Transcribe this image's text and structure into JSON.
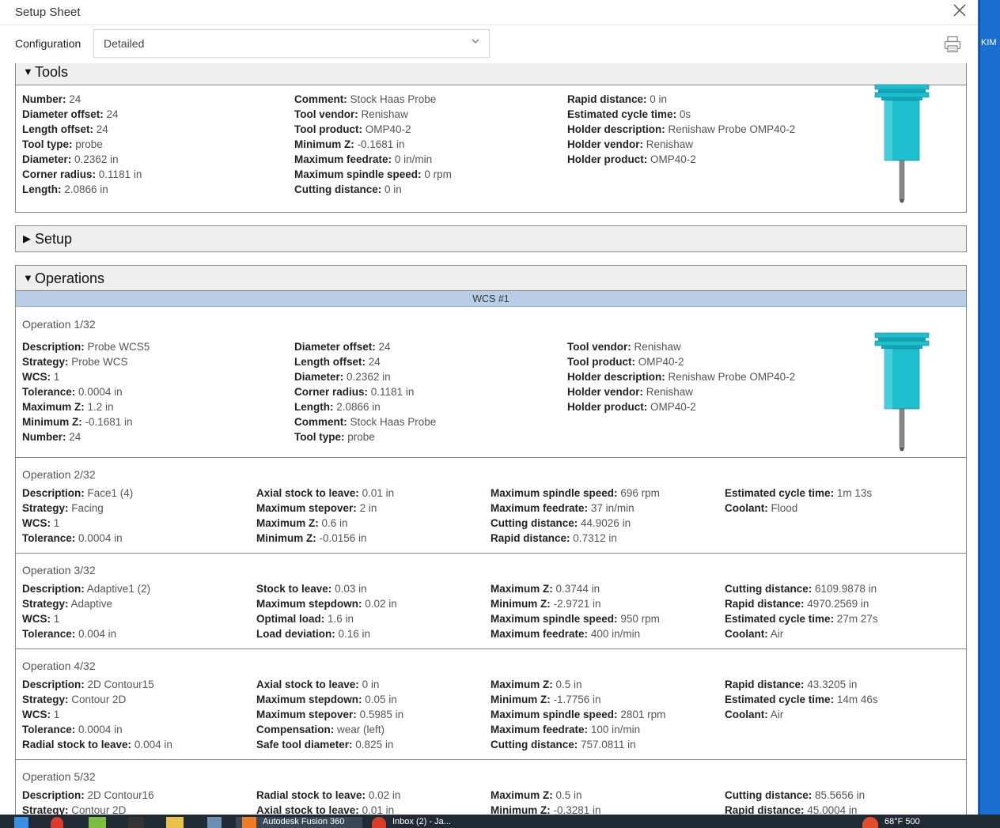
{
  "window": {
    "title": "Setup Sheet"
  },
  "config": {
    "label": "Configuration",
    "selected": "Detailed"
  },
  "edge": {
    "text": "KIM"
  },
  "icons": {
    "close": "close-icon",
    "print": "print-icon",
    "chevron": "chevron-down-icon"
  },
  "colors": {
    "wcs_bar": "#b9cde6",
    "tool_cyan": "#1fbfcf",
    "taskbar": "#1f2a35"
  },
  "tools": {
    "title": "Tools",
    "col1": [
      {
        "k": "Number:",
        "v": "24"
      },
      {
        "k": "Diameter offset:",
        "v": "24"
      },
      {
        "k": "Length offset:",
        "v": "24"
      },
      {
        "k": "Tool type:",
        "v": "probe"
      },
      {
        "k": "Diameter:",
        "v": "0.2362 in"
      },
      {
        "k": "Corner radius:",
        "v": "0.1181 in"
      },
      {
        "k": "Length:",
        "v": "2.0866 in"
      }
    ],
    "col2": [
      {
        "k": "Comment:",
        "v": "Stock Haas Probe"
      },
      {
        "k": "Tool vendor:",
        "v": "Renishaw"
      },
      {
        "k": "Tool product:",
        "v": "OMP40-2"
      },
      {
        "k": "Minimum Z:",
        "v": "-0.1681 in"
      },
      {
        "k": "Maximum feedrate:",
        "v": "0 in/min"
      },
      {
        "k": "Maximum spindle speed:",
        "v": "0 rpm"
      },
      {
        "k": "Cutting distance:",
        "v": "0 in"
      }
    ],
    "col3": [
      {
        "k": "Rapid distance:",
        "v": "0 in"
      },
      {
        "k": "Estimated cycle time:",
        "v": "0s"
      },
      {
        "k": "Holder description:",
        "v": "Renishaw Probe OMP40-2"
      },
      {
        "k": "Holder vendor:",
        "v": "Renishaw"
      },
      {
        "k": "Holder product:",
        "v": "OMP40-2"
      }
    ]
  },
  "setup": {
    "title": "Setup"
  },
  "operations": {
    "title": "Operations",
    "wcs": "WCS #1",
    "op1": {
      "title": "Operation 1/32",
      "col1": [
        {
          "k": "Description:",
          "v": "Probe WCS5"
        },
        {
          "k": "Strategy:",
          "v": "Probe WCS"
        },
        {
          "k": "WCS:",
          "v": "1"
        },
        {
          "k": "Tolerance:",
          "v": "0.0004 in"
        },
        {
          "k": "Maximum Z:",
          "v": "1.2 in"
        },
        {
          "k": "Minimum Z:",
          "v": "-0.1681 in"
        },
        {
          "k": "Number:",
          "v": "24"
        }
      ],
      "col2": [
        {
          "k": "Diameter offset:",
          "v": "24"
        },
        {
          "k": "Length offset:",
          "v": "24"
        },
        {
          "k": "Diameter:",
          "v": "0.2362 in"
        },
        {
          "k": "Corner radius:",
          "v": "0.1181 in"
        },
        {
          "k": "Length:",
          "v": "2.0866 in"
        },
        {
          "k": "Comment:",
          "v": "Stock Haas Probe"
        },
        {
          "k": "Tool type:",
          "v": "probe"
        }
      ],
      "col3": [
        {
          "k": "Tool vendor:",
          "v": "Renishaw"
        },
        {
          "k": "Tool product:",
          "v": "OMP40-2"
        },
        {
          "k": "Holder description:",
          "v": "Renishaw Probe OMP40-2"
        },
        {
          "k": "Holder vendor:",
          "v": "Renishaw"
        },
        {
          "k": "Holder product:",
          "v": "OMP40-2"
        }
      ]
    },
    "op2": {
      "title": "Operation 2/32",
      "col1": [
        {
          "k": "Description:",
          "v": "Face1 (4)"
        },
        {
          "k": "Strategy:",
          "v": "Facing"
        },
        {
          "k": "WCS:",
          "v": "1"
        },
        {
          "k": "Tolerance:",
          "v": "0.0004 in"
        }
      ],
      "col2": [
        {
          "k": "Axial stock to leave:",
          "v": "0.01 in"
        },
        {
          "k": "Maximum stepover:",
          "v": "2 in"
        },
        {
          "k": "Maximum Z:",
          "v": "0.6 in"
        },
        {
          "k": "Minimum Z:",
          "v": "-0.0156 in"
        }
      ],
      "col3": [
        {
          "k": "Maximum spindle speed:",
          "v": "696 rpm"
        },
        {
          "k": "Maximum feedrate:",
          "v": "37 in/min"
        },
        {
          "k": "Cutting distance:",
          "v": "44.9026 in"
        },
        {
          "k": "Rapid distance:",
          "v": "0.7312 in"
        }
      ],
      "col4": [
        {
          "k": "Estimated cycle time:",
          "v": "1m 13s"
        },
        {
          "k": "Coolant:",
          "v": "Flood"
        }
      ]
    },
    "op3": {
      "title": "Operation 3/32",
      "col1": [
        {
          "k": "Description:",
          "v": "Adaptive1 (2)"
        },
        {
          "k": "Strategy:",
          "v": "Adaptive"
        },
        {
          "k": "WCS:",
          "v": "1"
        },
        {
          "k": "Tolerance:",
          "v": "0.004 in"
        }
      ],
      "col2": [
        {
          "k": "Stock to leave:",
          "v": "0.03 in"
        },
        {
          "k": "Maximum stepdown:",
          "v": "0.02 in"
        },
        {
          "k": "Optimal load:",
          "v": "1.6 in"
        },
        {
          "k": "Load deviation:",
          "v": "0.16 in"
        }
      ],
      "col3": [
        {
          "k": "Maximum Z:",
          "v": "0.3744 in"
        },
        {
          "k": "Minimum Z:",
          "v": "-2.9721 in"
        },
        {
          "k": "Maximum spindle speed:",
          "v": "950 rpm"
        },
        {
          "k": "Maximum feedrate:",
          "v": "400 in/min"
        }
      ],
      "col4": [
        {
          "k": "Cutting distance:",
          "v": "6109.9878 in"
        },
        {
          "k": "Rapid distance:",
          "v": "4970.2569 in"
        },
        {
          "k": "Estimated cycle time:",
          "v": "27m 27s"
        },
        {
          "k": "Coolant:",
          "v": "Air"
        }
      ]
    },
    "op4": {
      "title": "Operation 4/32",
      "col1": [
        {
          "k": "Description:",
          "v": "2D Contour15"
        },
        {
          "k": "Strategy:",
          "v": "Contour 2D"
        },
        {
          "k": "WCS:",
          "v": "1"
        },
        {
          "k": "Tolerance:",
          "v": "0.0004 in"
        },
        {
          "k": "Radial stock to leave:",
          "v": "0.004 in"
        }
      ],
      "col2": [
        {
          "k": "Axial stock to leave:",
          "v": "0 in"
        },
        {
          "k": "Maximum stepdown:",
          "v": "0.05 in"
        },
        {
          "k": "Maximum stepover:",
          "v": "0.5985 in"
        },
        {
          "k": "Compensation:",
          "v": "wear (left)"
        },
        {
          "k": "Safe tool diameter:",
          "v": "0.825 in"
        }
      ],
      "col3": [
        {
          "k": "Maximum Z:",
          "v": "0.5 in"
        },
        {
          "k": "Minimum Z:",
          "v": "-1.7756 in"
        },
        {
          "k": "Maximum spindle speed:",
          "v": "2801 rpm"
        },
        {
          "k": "Maximum feedrate:",
          "v": "100 in/min"
        },
        {
          "k": "Cutting distance:",
          "v": "757.0811 in"
        }
      ],
      "col4": [
        {
          "k": "Rapid distance:",
          "v": "43.3205 in"
        },
        {
          "k": "Estimated cycle time:",
          "v": "14m 46s"
        },
        {
          "k": "Coolant:",
          "v": "Air"
        }
      ]
    },
    "op5": {
      "title": "Operation 5/32",
      "col1": [
        {
          "k": "Description:",
          "v": "2D Contour16"
        },
        {
          "k": "Strategy:",
          "v": "Contour 2D"
        }
      ],
      "col2": [
        {
          "k": "Radial stock to leave:",
          "v": "0.02 in"
        },
        {
          "k": "Axial stock to leave:",
          "v": "0.01 in"
        }
      ],
      "col3": [
        {
          "k": "Maximum Z:",
          "v": "0.5 in"
        },
        {
          "k": "Minimum Z:",
          "v": "-0.3281 in"
        }
      ],
      "col4": [
        {
          "k": "Cutting distance:",
          "v": "85.5656 in"
        },
        {
          "k": "Rapid distance:",
          "v": "45.0004 in"
        }
      ]
    }
  },
  "taskbar": {
    "app1": "Autodesk Fusion 360",
    "app2": "Inbox (2) - Ja...",
    "tray": "68°F  500"
  }
}
